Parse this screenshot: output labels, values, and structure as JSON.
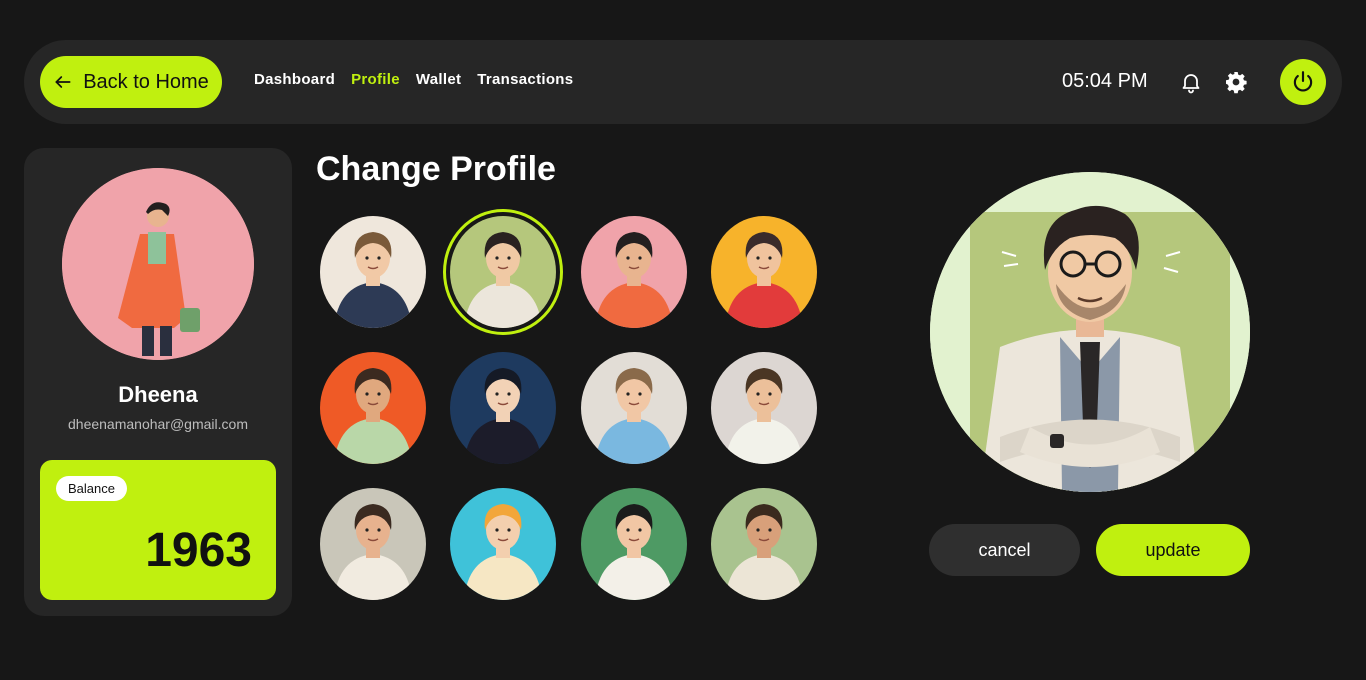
{
  "header": {
    "back_label": "Back to Home",
    "nav": [
      "Dashboard",
      "Profile",
      "Wallet",
      "Transactions"
    ],
    "active_nav": "Profile",
    "time": "05:04 PM"
  },
  "profile": {
    "name": "Dheena",
    "email": "dheenamanohar@gmail.com",
    "balance_label": "Balance",
    "balance_value": "1963"
  },
  "main": {
    "title": "Change Profile",
    "selected_avatar_index": 1,
    "avatars": [
      {
        "bg": "#efe7dc",
        "skin": "#f1c9a6",
        "hair": "#7a5a3a",
        "shirt": "#2d3a55"
      },
      {
        "bg": "#b5c77c",
        "skin": "#f0c9a4",
        "hair": "#2a2220",
        "shirt": "#ece6db"
      },
      {
        "bg": "#f0a3aa",
        "skin": "#e8b48f",
        "hair": "#231f1f",
        "shirt": "#f06a40"
      },
      {
        "bg": "#f7b32b",
        "skin": "#f0c39d",
        "hair": "#3a2b2b",
        "shirt": "#e23b3b"
      },
      {
        "bg": "#ef5a26",
        "skin": "#e0a87e",
        "hair": "#3b2a20",
        "shirt": "#b9d7a8"
      },
      {
        "bg": "#1e3a5f",
        "skin": "#f2d2b6",
        "hair": "#151a26",
        "shirt": "#1c1c2a"
      },
      {
        "bg": "#e2ddd6",
        "skin": "#f1c7a5",
        "hair": "#8a6a4a",
        "shirt": "#7ab8e0"
      },
      {
        "bg": "#dcd6d2",
        "skin": "#ecc09a",
        "hair": "#4a3624",
        "shirt": "#f2f2ea"
      },
      {
        "bg": "#c9c6b9",
        "skin": "#e7b28e",
        "hair": "#3a2a20",
        "shirt": "#f1ebe0"
      },
      {
        "bg": "#3fc2d9",
        "skin": "#f3cfae",
        "hair": "#f2a63a",
        "shirt": "#f6e7c4"
      },
      {
        "bg": "#4e9a64",
        "skin": "#f1c6a4",
        "hair": "#1b1b1b",
        "shirt": "#f3f0e8"
      },
      {
        "bg": "#a9c38f",
        "skin": "#d8a07a",
        "hair": "#3a2a1e",
        "shirt": "#ece5d6"
      }
    ]
  },
  "actions": {
    "cancel_label": "cancel",
    "update_label": "update"
  },
  "colors": {
    "accent": "#c0f00f",
    "background": "#171717",
    "panel": "#262626"
  },
  "icons": [
    "arrow-left-icon",
    "bell-icon",
    "gear-icon",
    "power-icon"
  ]
}
